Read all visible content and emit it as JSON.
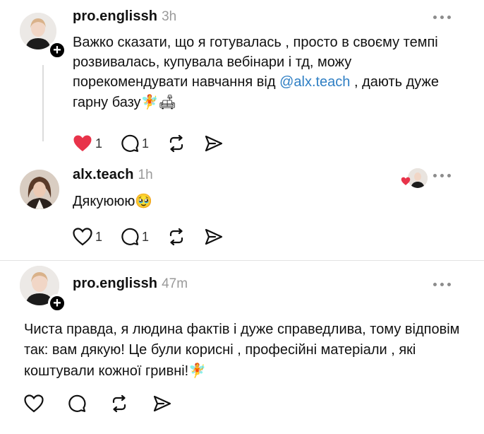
{
  "posts": [
    {
      "username": "pro.englissh",
      "time": "3h",
      "text_before": "Важко сказати, що я готувалась , просто в своєму темпі розвивалась, купувала вебінари і тд, можу порекомендувати навчання від ",
      "mention": "@alx.teach",
      "text_after": " , дають дуже гарну базу",
      "emoji": "🧚🛋",
      "likes": "1",
      "replies": "1",
      "liked": true
    },
    {
      "username": "alx.teach",
      "time": "1h",
      "text": "Дякуююю",
      "emoji": "🥹",
      "likes": "1",
      "replies": "1",
      "liked": false
    },
    {
      "username": "pro.englissh",
      "time": "47m",
      "text": "Чиста правда, я людина фактів і дуже справедлива, тому відповім так: вам дякую! Це були корисні , професійні матеріали , які коштували кожної гривні!",
      "emoji": "🧚",
      "liked": false
    }
  ],
  "icons": {
    "like": "heart-icon",
    "reply": "comment-icon",
    "repost": "repost-icon",
    "share": "send-icon",
    "more": "more-icon",
    "follow": "plus-icon"
  },
  "colors": {
    "like_active": "#e8334a",
    "mention": "#2f7fc4",
    "time": "#9a9a9a"
  }
}
